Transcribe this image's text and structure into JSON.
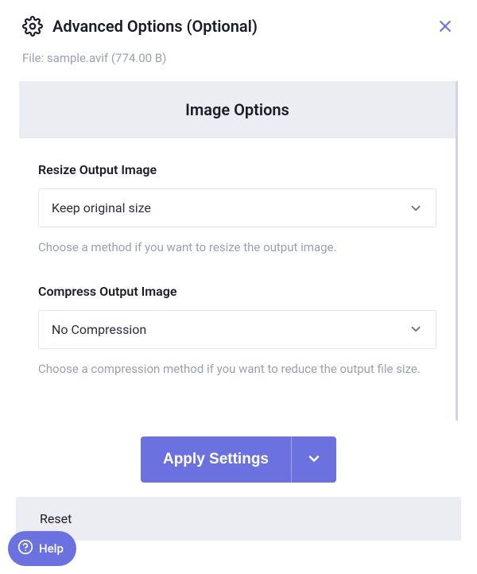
{
  "header": {
    "title": "Advanced Options (Optional)"
  },
  "file": {
    "label": "File:",
    "name": "sample.avif",
    "size": "(774.00 B)"
  },
  "panel": {
    "title": "Image Options",
    "resize": {
      "label": "Resize Output Image",
      "value": "Keep original size",
      "help": "Choose a method if you want to resize the output image."
    },
    "compress": {
      "label": "Compress Output Image",
      "value": "No Compression",
      "help": "Choose a compression method if you want to reduce the output file size."
    }
  },
  "actions": {
    "apply": "Apply Settings",
    "reset": "Reset"
  },
  "help": {
    "label": "Help"
  }
}
